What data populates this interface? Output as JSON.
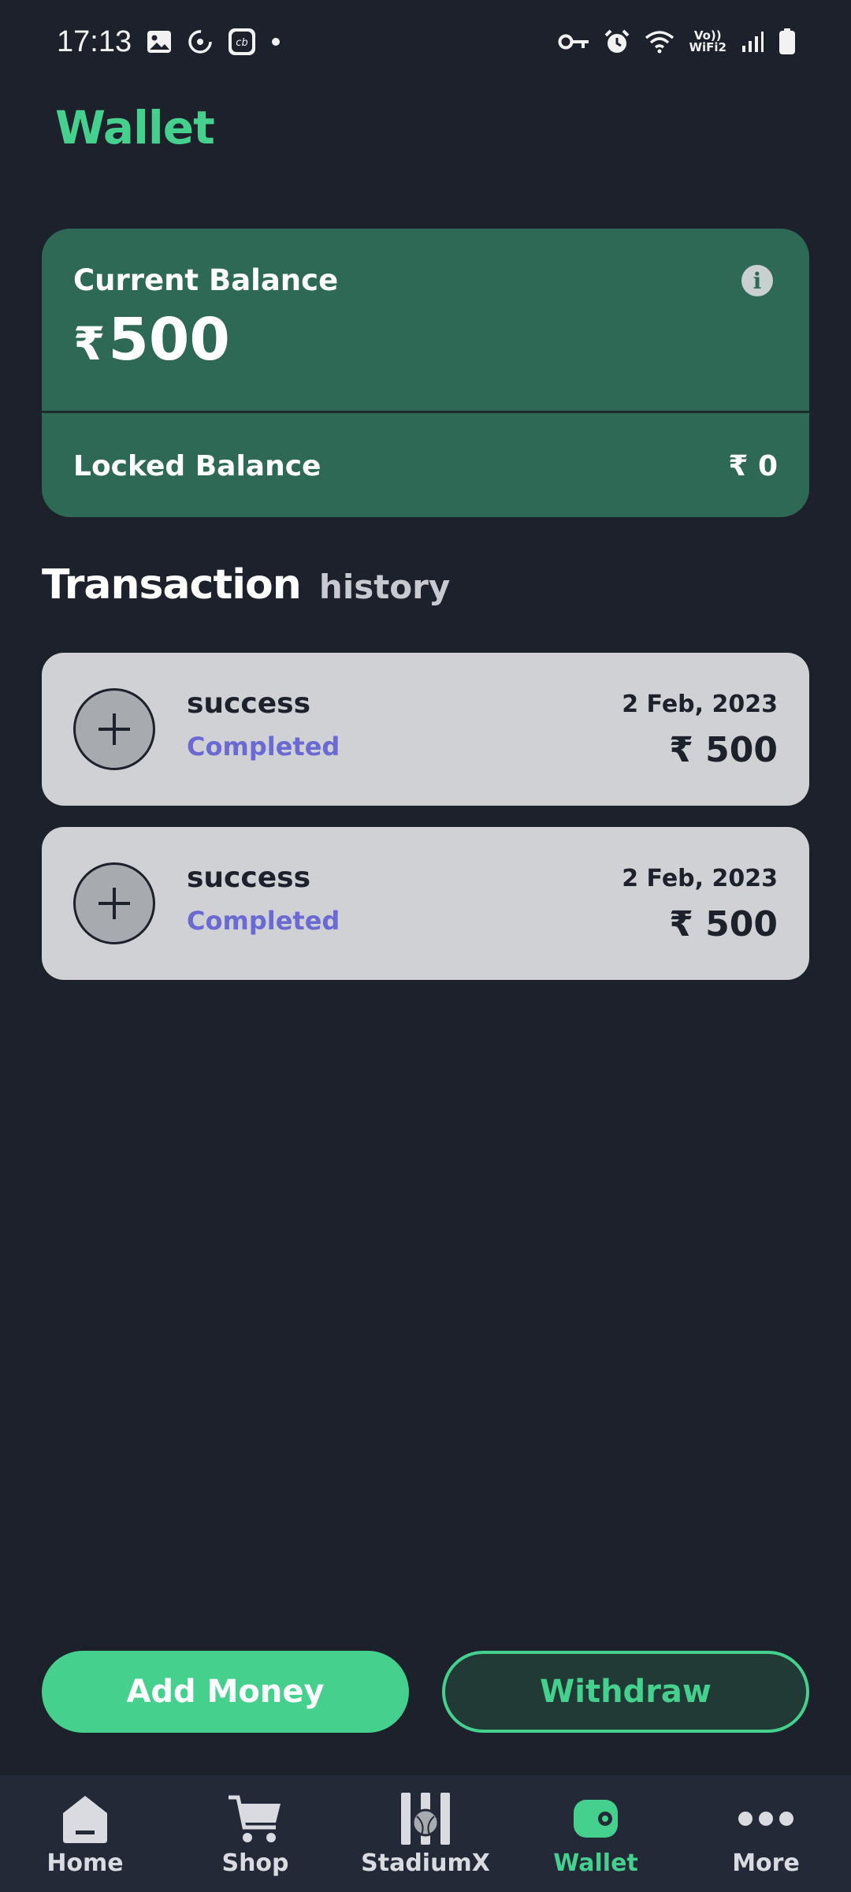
{
  "status_bar": {
    "time": "17:13",
    "wifi_label_top": "Vo))",
    "wifi_label_bottom": "WiFi2",
    "icons": [
      "image-icon",
      "sync-icon",
      "cb-app-icon",
      "dot-icon",
      "vpn-key-icon",
      "alarm-icon",
      "wifi-icon",
      "signal-icon",
      "battery-icon"
    ]
  },
  "header": {
    "title": "Wallet"
  },
  "balance_card": {
    "current_label": "Current Balance",
    "current_currency": "₹",
    "current_amount": "500",
    "locked_label": "Locked Balance",
    "locked_value": "₹ 0",
    "info_icon": "i"
  },
  "transactions": {
    "title": "Transaction",
    "subtitle": "history",
    "items": [
      {
        "title": "success",
        "status": "Completed",
        "date": "2 Feb, 2023",
        "amount": "₹ 500"
      },
      {
        "title": "success",
        "status": "Completed",
        "date": "2 Feb, 2023",
        "amount": "₹ 500"
      }
    ]
  },
  "actions": {
    "add_money": "Add Money",
    "withdraw": "Withdraw"
  },
  "bottom_nav": {
    "items": [
      {
        "label": "Home",
        "icon": "home-icon"
      },
      {
        "label": "Shop",
        "icon": "cart-icon"
      },
      {
        "label": "StadiumX",
        "icon": "stadium-icon"
      },
      {
        "label": "Wallet",
        "icon": "wallet-icon"
      },
      {
        "label": "More",
        "icon": "more-icon"
      }
    ],
    "active": "Wallet"
  },
  "colors": {
    "background": "#1c212b",
    "accent": "#45d08e",
    "card": "#2d6954",
    "transaction_card": "#d0d1d5",
    "status_completed": "#6a6ad2"
  }
}
